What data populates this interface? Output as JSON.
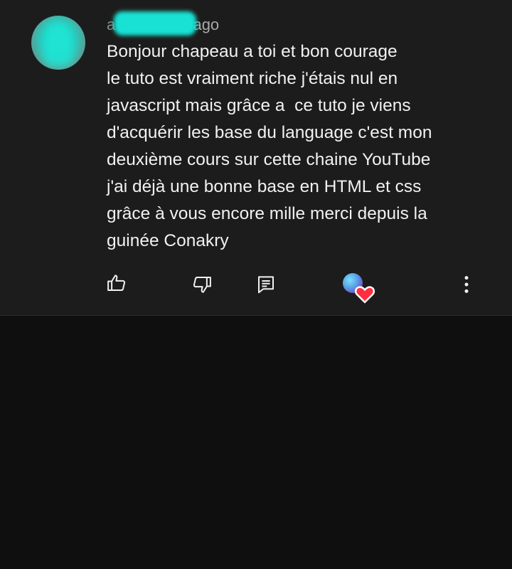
{
  "comment": {
    "author": "a",
    "separator": "•",
    "timestamp": "1 month ago",
    "lines": [
      "Bonjour chapeau a toi et bon courage",
      "le tuto est vraiment riche j'étais nul en",
      "javascript mais grâce a  ce tuto je viens",
      "d'acquérir les base du language c'est mon",
      "deuxième cours sur cette chaine YouTube",
      "j'ai déjà une bonne base en HTML et css",
      "grâce à vous encore mille merci depuis la",
      "guinée Conakry"
    ]
  },
  "actions": {
    "like_icon": "thumbs-up-icon",
    "dislike_icon": "thumbs-down-icon",
    "reply_icon": "comment-icon",
    "creator_heart_icon": "creator-heart-icon",
    "more_icon": "more-vert-icon"
  },
  "colors": {
    "background": "#0f0f0f",
    "card": "#1c1c1c",
    "text": "#f1f1f1",
    "meta": "#a9a9a9",
    "heart": "#ff2d3d"
  }
}
